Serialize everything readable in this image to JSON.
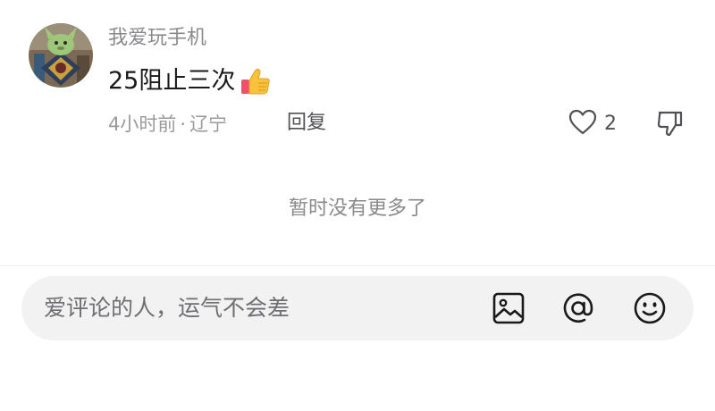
{
  "comment": {
    "username": "我爱玩手机",
    "text": "25阻止三次",
    "emoji_icon": "thumbs-up-emoji-icon",
    "time": "4小时前",
    "separator": "·",
    "location": "辽宁",
    "reply_label": "回复",
    "like_count": "2"
  },
  "footer": {
    "no_more_text": "暂时没有更多了"
  },
  "input_bar": {
    "placeholder": "爱评论的人，运气不会差",
    "icons": [
      "image-icon",
      "at-icon",
      "emoji-icon"
    ]
  },
  "colors": {
    "username": "#8a8a8e",
    "text": "#1a1a1a",
    "meta": "#9a9a9e",
    "input_bg": "#f2f2f3"
  }
}
